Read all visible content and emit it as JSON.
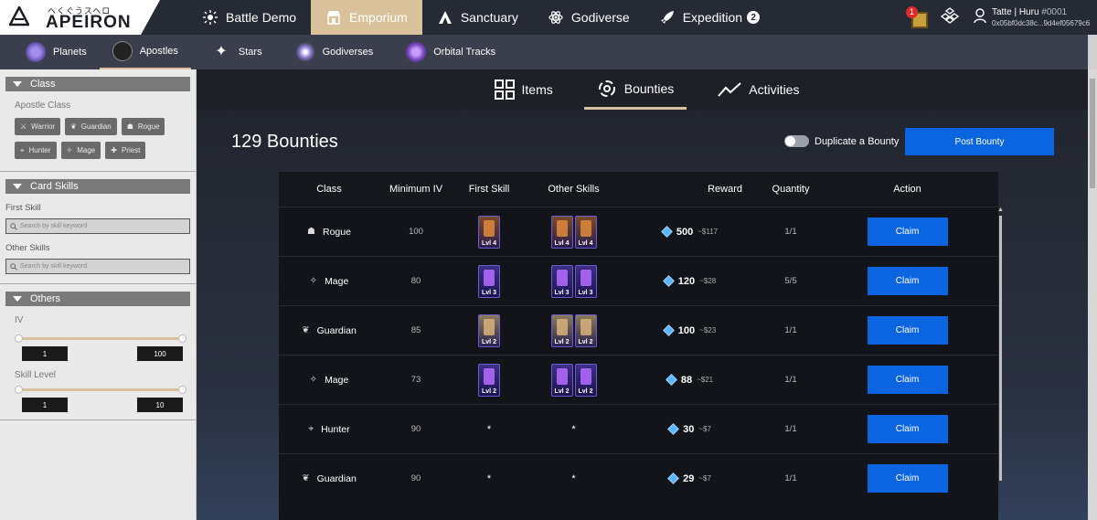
{
  "logo": {
    "subtitle": "ヘくぐうスヘロ",
    "name": "APEIRON"
  },
  "mainnav": [
    {
      "label": "Battle Demo",
      "icon": "sparkle-burst-icon"
    },
    {
      "label": "Emporium",
      "icon": "shop-icon",
      "active": true
    },
    {
      "label": "Sanctuary",
      "icon": "temple-icon"
    },
    {
      "label": "Godiverse",
      "icon": "atom-icon"
    },
    {
      "label": "Expedition",
      "icon": "rocket-icon",
      "badge": "2"
    }
  ],
  "notifications": {
    "count": "1"
  },
  "user": {
    "name": "Tatte | Huru",
    "tag": "#0001",
    "address": "0x05bf0dc38c...9d4ef05679c6"
  },
  "subnav": [
    {
      "label": "Planets"
    },
    {
      "label": "Apostles",
      "active": true
    },
    {
      "label": "Stars"
    },
    {
      "label": "Godiverses"
    },
    {
      "label": "Orbital Tracks"
    }
  ],
  "sidebar": {
    "class_section": "Class",
    "apostle_class_label": "Apostle Class",
    "classes": [
      "Warrior",
      "Guardian",
      "Rogue",
      "Hunter",
      "Mage",
      "Priest"
    ],
    "card_skills_section": "Card Skills",
    "first_skill_label": "First Skill",
    "other_skills_label": "Other Skills",
    "search_placeholder": "Search by skill keyword",
    "others_section": "Others",
    "iv_label": "IV",
    "iv_min": "1",
    "iv_max": "100",
    "skill_level_label": "Skill Level",
    "skill_min": "1",
    "skill_max": "10"
  },
  "tabs": [
    {
      "label": "Items"
    },
    {
      "label": "Bounties",
      "active": true
    },
    {
      "label": "Activities"
    }
  ],
  "bounties": {
    "title": "129 Bounties",
    "duplicate_label": "Duplicate a Bounty",
    "post_label": "Post Bounty",
    "columns": [
      "Class",
      "Minimum IV",
      "First Skill",
      "Other Skills",
      "Reward",
      "Quantity",
      "Action"
    ],
    "rows": [
      {
        "class": "Rogue",
        "min_iv": "100",
        "first": [
          {
            "lvl": "Lvl 4",
            "style": "orange"
          }
        ],
        "other": [
          {
            "lvl": "Lvl 4",
            "style": "orange"
          },
          {
            "lvl": "Lvl 4",
            "style": "orange"
          }
        ],
        "reward": "500",
        "usd": "~$117",
        "qty": "1/1",
        "action": "Claim"
      },
      {
        "class": "Mage",
        "min_iv": "80",
        "first": [
          {
            "lvl": "Lvl 3",
            "style": "purple"
          }
        ],
        "other": [
          {
            "lvl": "Lvl 3",
            "style": "purple"
          },
          {
            "lvl": "Lvl 3",
            "style": "purple"
          }
        ],
        "reward": "120",
        "usd": "~$28",
        "qty": "5/5",
        "action": "Claim"
      },
      {
        "class": "Guardian",
        "min_iv": "85",
        "first": [
          {
            "lvl": "Lvl 2",
            "style": "gold"
          }
        ],
        "other": [
          {
            "lvl": "Lvl 2",
            "style": "gold"
          },
          {
            "lvl": "Lvl 2",
            "style": "gold"
          }
        ],
        "reward": "100",
        "usd": "~$23",
        "qty": "1/1",
        "action": "Claim"
      },
      {
        "class": "Mage",
        "min_iv": "73",
        "first": [
          {
            "lvl": "Lvl 2",
            "style": "purple"
          }
        ],
        "other": [
          {
            "lvl": "Lvl 2",
            "style": "purple"
          },
          {
            "lvl": "Lvl 2",
            "style": "purple"
          }
        ],
        "reward": "88",
        "usd": "~$21",
        "qty": "1/1",
        "action": "Claim"
      },
      {
        "class": "Hunter",
        "min_iv": "90",
        "first": [],
        "other": [],
        "any": "*",
        "reward": "30",
        "usd": "~$7",
        "qty": "1/1",
        "action": "Claim"
      },
      {
        "class": "Guardian",
        "min_iv": "90",
        "first": [],
        "other": [],
        "any": "*",
        "reward": "29",
        "usd": "~$7",
        "qty": "1/1",
        "action": "Claim"
      }
    ]
  },
  "colors": {
    "accent": "#d9c29b",
    "primary_button": "#0b65e1",
    "topbar": "#262a35",
    "subbar": "#3a3e4d"
  }
}
